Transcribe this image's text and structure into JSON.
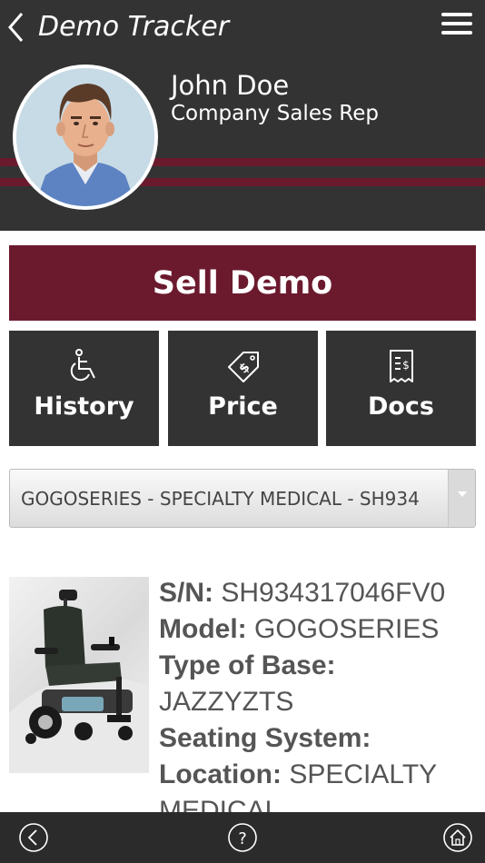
{
  "header": {
    "title": "Demo Tracker",
    "user_name": "John Doe",
    "user_role": "Company Sales Rep",
    "accent_color": "#6b1a2e"
  },
  "actions": {
    "sell_demo": "Sell Demo",
    "tiles": [
      {
        "label": "History",
        "icon": "wheelchair-icon"
      },
      {
        "label": "Price",
        "icon": "price-tag-icon"
      },
      {
        "label": "Docs",
        "icon": "receipt-icon"
      }
    ]
  },
  "selector": {
    "value": "GOGOSERIES - SPECIALTY MEDICAL - SH934"
  },
  "product": {
    "fields": [
      {
        "label": "S/N:",
        "value": "SH934317046FV0"
      },
      {
        "label": "Model:",
        "value": "GOGOSERIES"
      },
      {
        "label": "Type of Base:",
        "value": "JAZZYZTS"
      },
      {
        "label": "Seating System:",
        "value": ""
      },
      {
        "label": "Location:",
        "value": "SPECIALTY MEDICAL"
      }
    ]
  },
  "footer": {
    "buttons": [
      "back-circle-icon",
      "help-icon",
      "home-icon"
    ]
  }
}
